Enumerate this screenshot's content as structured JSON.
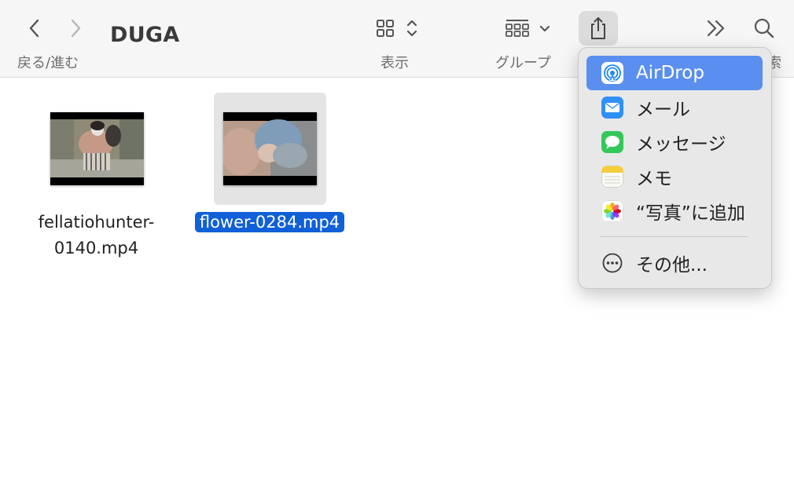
{
  "toolbar": {
    "title": "DUGA",
    "nav_label": "戻る/進む",
    "view_label": "表示",
    "group_label": "グループ",
    "search_label_partial": "索"
  },
  "files": [
    {
      "name": "fellatiohunter-0140.mp4",
      "selected": false
    },
    {
      "name": "flower-0284.mp4",
      "selected": true
    }
  ],
  "share_menu": {
    "items": [
      {
        "label": "AirDrop",
        "icon": "airdrop-icon",
        "highlighted": true
      },
      {
        "label": "メール",
        "icon": "mail-icon"
      },
      {
        "label": "メッセージ",
        "icon": "messages-icon"
      },
      {
        "label": "メモ",
        "icon": "notes-icon"
      },
      {
        "label": "“写真”に追加",
        "icon": "photos-icon"
      }
    ],
    "more": {
      "label": "その他...",
      "icon": "more-circle-icon"
    }
  },
  "colors": {
    "selection_blue": "#1060d8",
    "menu_highlight": "#5a8ff0",
    "toolbar_bg": "#f6f6f6",
    "menu_bg": "#e8e8e8"
  }
}
